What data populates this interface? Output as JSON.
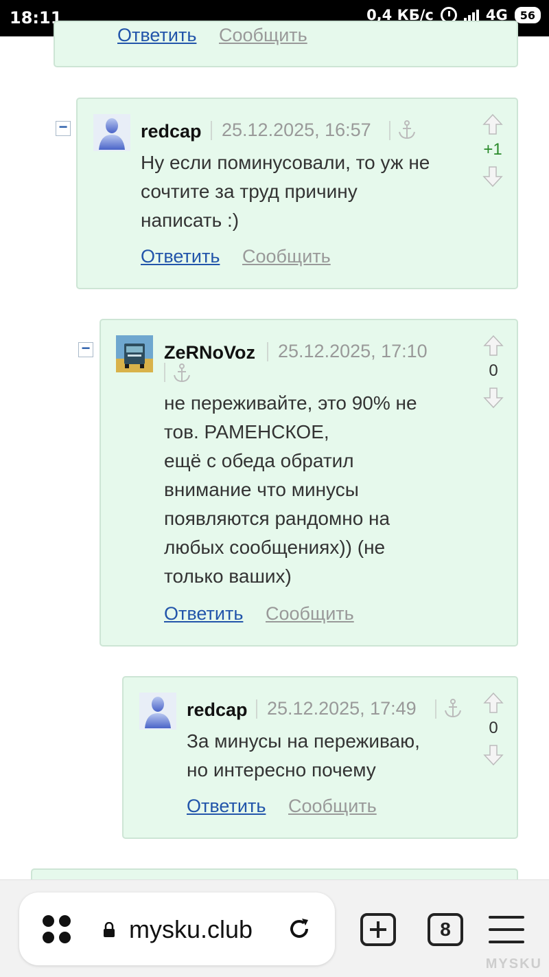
{
  "status_bar": {
    "time": "18:11",
    "speed": "0,4 КБ/с",
    "network": "4G",
    "battery": "56"
  },
  "top_partial": {
    "reply_label": "Ответить",
    "report_label": "Сообщить"
  },
  "comments": [
    {
      "author": "redcap",
      "date": "25.12.2025, 16:57",
      "text_lines": [
        "Ну если поминусовали, то уж не",
        "сочтите за труд причину",
        "написать :)"
      ],
      "score": "+1",
      "reply_label": "Ответить",
      "report_label": "Сообщить",
      "collapse_label": "−"
    },
    {
      "author": "ZeRNoVoz",
      "date": "25.12.2025, 17:10",
      "text_lines": [
        "не переживайте, это 90% не",
        "тов. РАМЕНСКОЕ,",
        "ещё с обеда обратил",
        "внимание что минусы",
        "появляются рандомно на",
        "любых сообщениях)) (не",
        "только ваших)"
      ],
      "score": "0",
      "reply_label": "Ответить",
      "report_label": "Сообщить",
      "collapse_label": "−"
    },
    {
      "author": "redcap",
      "date": "25.12.2025, 17:49",
      "text_lines": [
        "За минусы на переживаю,",
        "но интересно почему"
      ],
      "score": "0",
      "reply_label": "Ответить",
      "report_label": "Сообщить"
    }
  ],
  "browser": {
    "url": "mysku.club",
    "tab_count": "8"
  },
  "watermark": "MYSKU"
}
